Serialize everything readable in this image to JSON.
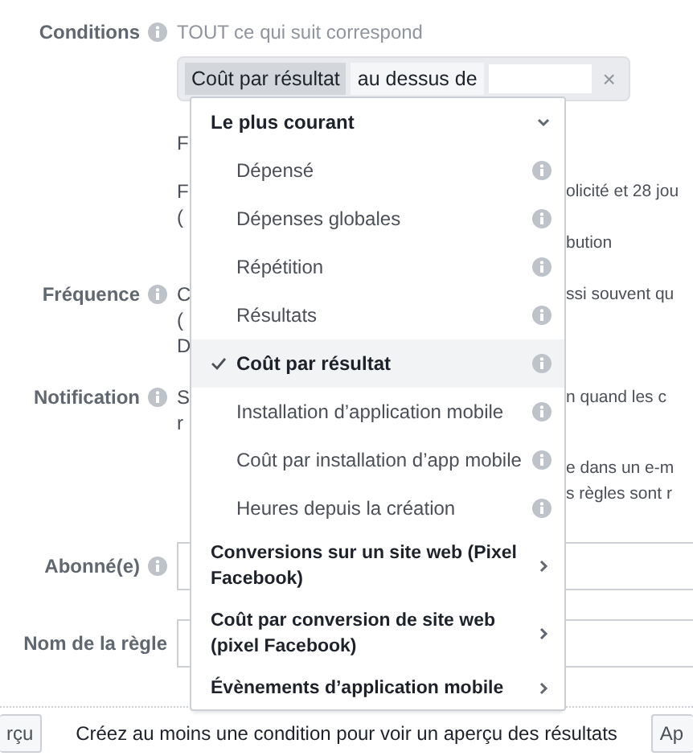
{
  "conditions": {
    "label": "Conditions",
    "info": true,
    "summary": "TOUT ce qui suit correspond",
    "metric": "Coût par résultat",
    "operator": "au dessus de",
    "clear": "×",
    "paragraphs": [
      [
        {
          "left": "F"
        }
      ],
      [
        {
          "left": "F",
          "right": "olicité et 28 jou"
        },
        {
          "left": "("
        },
        {
          "right": "bution"
        }
      ]
    ]
  },
  "rows": [
    {
      "kind": "text",
      "label": "Fréquence",
      "info": true,
      "paragraphs": [
        [
          {
            "left": "C",
            "right": "ssi souvent qu"
          },
          {
            "left": "("
          },
          {
            "left": "D"
          }
        ]
      ]
    },
    {
      "kind": "text",
      "label": "Notification",
      "info": true,
      "paragraphs": [
        [
          {
            "left": "S",
            "right": "n quand les c"
          },
          {
            "left": "r"
          }
        ],
        [
          {
            "right": "e dans un e-m"
          },
          {
            "right": "s règles sont r"
          }
        ]
      ]
    },
    {
      "kind": "field",
      "label": "Abonné(e)",
      "info": true
    },
    {
      "kind": "field",
      "label": "Nom de la règle",
      "info": false
    }
  ],
  "menu": [
    {
      "kind": "header",
      "label": "Le plus courant",
      "expanded": true
    },
    {
      "kind": "item",
      "label": "Dépensé",
      "selected": false
    },
    {
      "kind": "item",
      "label": "Dépenses globales",
      "selected": false
    },
    {
      "kind": "item",
      "label": "Répétition",
      "selected": false
    },
    {
      "kind": "item",
      "label": "Résultats",
      "selected": false
    },
    {
      "kind": "item",
      "label": "Coût par résultat",
      "selected": true
    },
    {
      "kind": "item",
      "label": "Installation d’application mobile",
      "selected": false
    },
    {
      "kind": "item",
      "label": "Coût par installation d’app mobile",
      "selected": false
    },
    {
      "kind": "item",
      "label": "Heures depuis la création",
      "selected": false
    },
    {
      "kind": "group",
      "label": "Conversions sur un site web (Pixel Facebook)",
      "expanded": false
    },
    {
      "kind": "group",
      "label": "Coût par conversion de site web (pixel Facebook)",
      "expanded": false
    },
    {
      "kind": "group",
      "label": "Évènements d’application mobile",
      "expanded": false
    }
  ],
  "footer": {
    "left_button": "rçu",
    "message": "Créez au moins une condition pour voir un aperçu des résultats",
    "right_button": "Ap"
  }
}
